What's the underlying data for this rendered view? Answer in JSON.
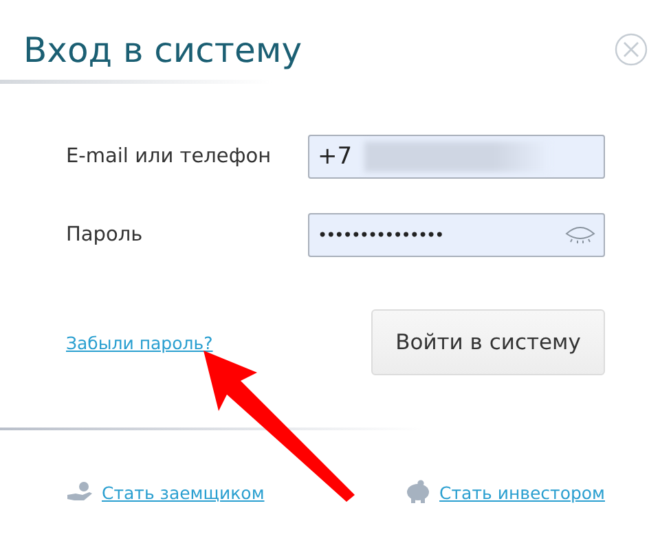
{
  "dialog": {
    "title": "Вход в систему"
  },
  "fields": [
    {
      "label": "E-mail или телефон",
      "kind": "text",
      "value": "+7",
      "redacted": true
    },
    {
      "label": "Пароль",
      "kind": "password",
      "value": "•••••••••••••••"
    }
  ],
  "forgot_link": "Забыли пароль?",
  "submit_button": "Войти в систему",
  "footer_links": [
    {
      "label": "Стать заемщиком",
      "kind": "borrower"
    },
    {
      "label": "Стать инвестором",
      "kind": "investor"
    }
  ],
  "annotation": {
    "kind": "arrow"
  }
}
